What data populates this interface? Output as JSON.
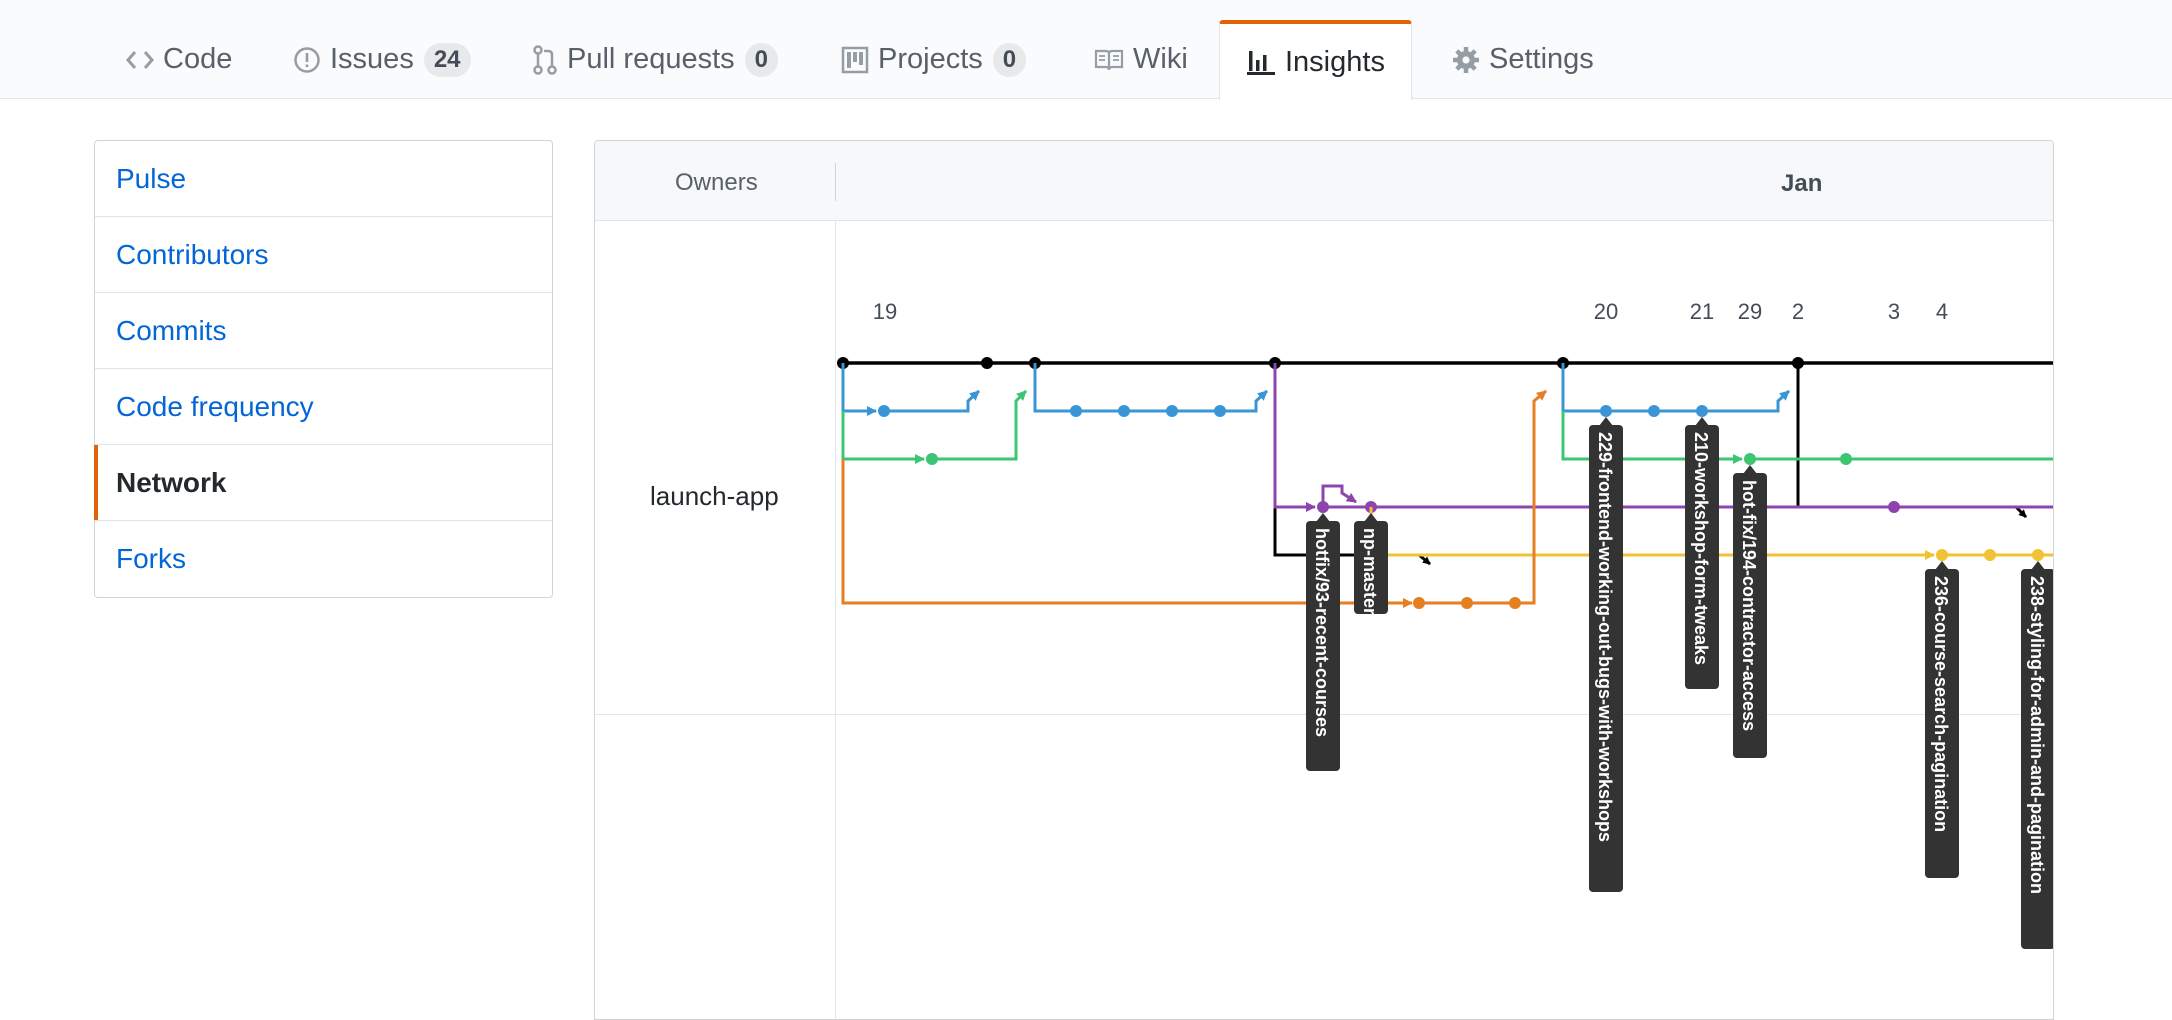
{
  "repo_nav": {
    "tabs": [
      {
        "label": "Code",
        "icon": "code-icon"
      },
      {
        "label": "Issues",
        "icon": "issue-opened-icon",
        "count": "24"
      },
      {
        "label": "Pull requests",
        "icon": "git-pull-request-icon",
        "count": "0"
      },
      {
        "label": "Projects",
        "icon": "project-icon",
        "count": "0"
      },
      {
        "label": "Wiki",
        "icon": "book-icon"
      },
      {
        "label": "Insights",
        "icon": "graph-icon",
        "selected": true
      },
      {
        "label": "Settings",
        "icon": "gear-icon"
      }
    ],
    "accent_color": "#e36209"
  },
  "insights_menu": {
    "items": [
      {
        "label": "Pulse"
      },
      {
        "label": "Contributors"
      },
      {
        "label": "Commits"
      },
      {
        "label": "Code frequency"
      },
      {
        "label": "Network",
        "selected": true
      },
      {
        "label": "Forks"
      }
    ]
  },
  "network": {
    "owners_header": "Owners",
    "month": "Jan",
    "owner": "launch-app",
    "day_labels": [
      "19",
      "20",
      "21",
      "29",
      "2",
      "3",
      "4"
    ],
    "branch_labels": [
      "hotfix/93-recent-courses",
      "np-master",
      "229-frontend-working-out-bugs-with-workshops",
      "210-workshop-form-tweaks",
      "hot-fix/194-contractor-access",
      "236-course-search-pagination",
      "238-styling-for-admin-and-pagination"
    ],
    "colors": {
      "master": "#000000",
      "blue": "#3a95d6",
      "green": "#3cc572",
      "purple": "#8e44ad",
      "yellow": "#f1c232",
      "orange": "#e67e22",
      "label_bg": "#333333"
    }
  }
}
